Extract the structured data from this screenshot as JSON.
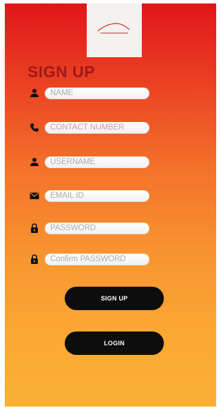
{
  "form": {
    "title": "SIGN UP",
    "fields": [
      {
        "placeholder": "NAME",
        "icon": "person-icon"
      },
      {
        "placeholder": "CONTACT NUMBER",
        "icon": "phone-icon"
      },
      {
        "placeholder": "USERNAME",
        "icon": "person-icon"
      },
      {
        "placeholder": "EMAIL ID",
        "icon": "mail-icon"
      },
      {
        "placeholder": "PASSWORD",
        "icon": "lock-icon"
      },
      {
        "placeholder": "Confirm PASSWORD",
        "icon": "lock-icon"
      }
    ],
    "signup_label": "SIGN UP",
    "login_label": "LOGIN"
  },
  "colors": {
    "gradient_top": "#e0161a",
    "gradient_bottom": "#fbb034",
    "title": "#9e1a19",
    "button": "#0e0d0d"
  }
}
